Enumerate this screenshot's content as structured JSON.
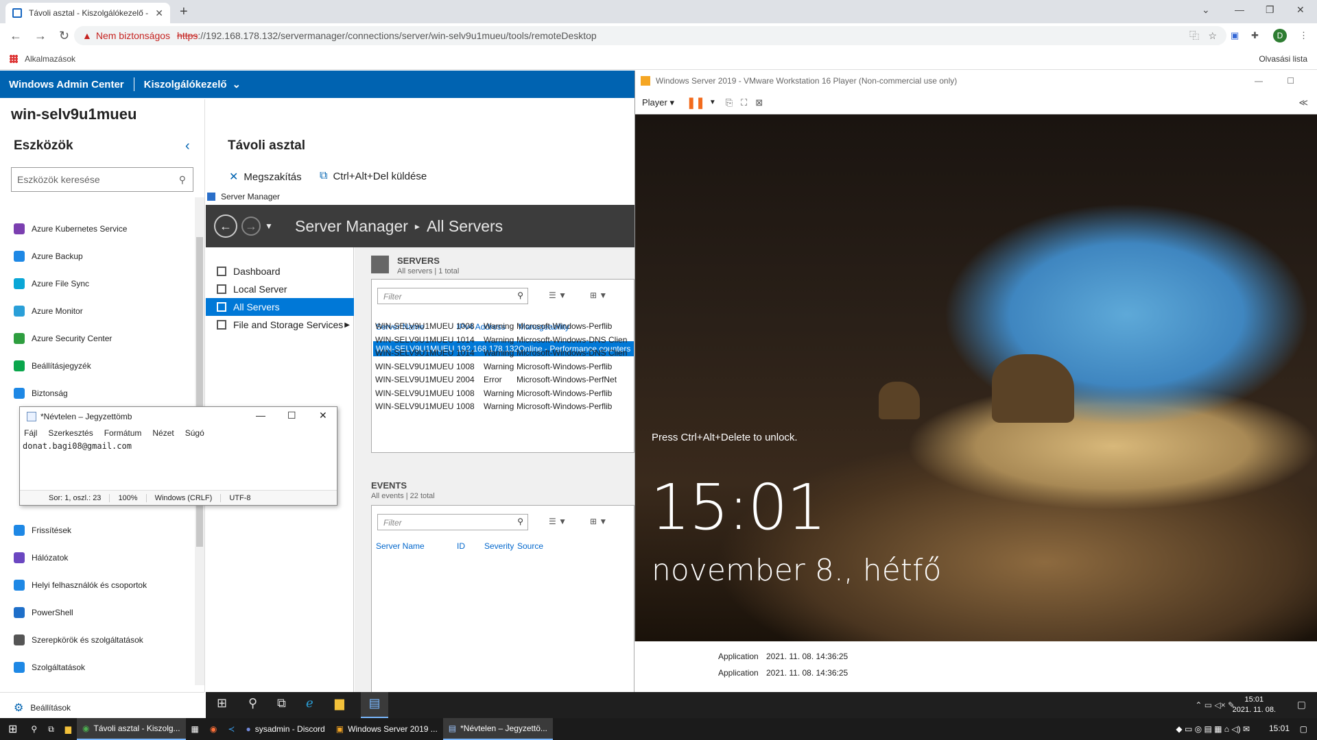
{
  "browser": {
    "tab_title": "Távoli asztal - Kiszolgálókezelő -",
    "url_warning": "Nem biztonságos",
    "url_scheme": "https",
    "url_rest": "://192.168.178.132/servermanager/connections/server/win-selv9u1mueu/tools/remoteDesktop",
    "bookmarks_apps": "Alkalmazások",
    "reading_list": "Olvasási lista",
    "profile_initial": "D"
  },
  "wac": {
    "brand": "Windows Admin Center",
    "section": "Kiszolgálókezelő",
    "server": "win-selv9u1mueu",
    "tools_heading": "Eszközök",
    "search_placeholder": "Eszközök keresése",
    "tools": [
      "Azure Kubernetes Service",
      "Azure Backup",
      "Azure File Sync",
      "Azure Monitor",
      "Azure Security Center",
      "Beállításjegyzék",
      "Biztonság",
      "Frissítések",
      "Hálózatok",
      "Helyi felhasználók és csoportok",
      "PowerShell",
      "Szerepkörök és szolgáltatások",
      "Szolgáltatások"
    ],
    "tool_colors": [
      "#7b3fb0",
      "#1e88e5",
      "#0aa6d6",
      "#2a9fd8",
      "#2e9e3f",
      "#0aa64c",
      "#1e88e5",
      "#1e88e5",
      "#6b47c1",
      "#1e88e5",
      "#1e6fc9",
      "#555555",
      "#1e88e5"
    ],
    "settings": "Beállítások",
    "rd_title": "Távoli asztal",
    "disconnect": "Megszakítás",
    "cad": "Ctrl+Alt+Del küldése"
  },
  "servermanager": {
    "label": "Server Manager",
    "crumb1": "Server Manager",
    "crumb2": "All Servers",
    "nav": [
      "Dashboard",
      "Local Server",
      "All Servers",
      "File and Storage Services"
    ],
    "servers_title": "SERVERS",
    "servers_sub": "All servers | 1 total",
    "filter": "Filter",
    "cols": [
      "Server Name",
      "IPv4 Address",
      "Manageability"
    ],
    "server_row": [
      "WIN-SELV9U1MUEU",
      "192.168.178.132",
      "Online - Performance counters"
    ],
    "events_title": "EVENTS",
    "events_sub": "All events | 22 total",
    "ev_cols": [
      "Server Name",
      "ID",
      "Severity",
      "Source"
    ],
    "events": [
      [
        "WIN-SELV9U1MUEU",
        "1008",
        "Warning",
        "Microsoft-Windows-Perflib"
      ],
      [
        "WIN-SELV9U1MUEU",
        "1014",
        "Warning",
        "Microsoft-Windows-DNS Clien"
      ],
      [
        "WIN-SELV9U1MUEU",
        "1014",
        "Warning",
        "Microsoft-Windows-DNS Clien"
      ],
      [
        "WIN-SELV9U1MUEU",
        "1008",
        "Warning",
        "Microsoft-Windows-Perflib"
      ],
      [
        "WIN-SELV9U1MUEU",
        "2004",
        "Error",
        "Microsoft-Windows-PerfNet"
      ],
      [
        "WIN-SELV9U1MUEU",
        "1008",
        "Warning",
        "Microsoft-Windows-Perflib"
      ],
      [
        "WIN-SELV9U1MUEU",
        "1008",
        "Warning",
        "Microsoft-Windows-Perflib"
      ]
    ],
    "ev_extra": [
      [
        "Application",
        "2021. 11. 08. 14:36:25"
      ],
      [
        "Application",
        "2021. 11. 08. 14:36:25"
      ]
    ]
  },
  "notepad": {
    "title": "*Névtelen – Jegyzettömb",
    "menu": [
      "Fájl",
      "Szerkesztés",
      "Formátum",
      "Nézet",
      "Súgó"
    ],
    "text": "donat.bagi08@gmail.com",
    "status": [
      "Sor: 1, oszl.: 23",
      "100%",
      "Windows (CRLF)",
      "UTF-8"
    ]
  },
  "vmware": {
    "title": "Windows Server 2019 - VMware Workstation 16 Player (Non-commercial use only)",
    "player": "Player",
    "press": "Press Ctrl+Alt+Delete to unlock.",
    "time": "15:01",
    "date": "november 8., hétfő"
  },
  "inner_taskbar": {
    "time": "15:01",
    "date": "2021. 11. 08."
  },
  "outer_taskbar": {
    "items": [
      "Távoli asztal - Kiszolg...",
      "sysadmin - Discord",
      "Windows Server 2019 ...",
      "*Névtelen – Jegyzettö..."
    ],
    "time": "15:01"
  }
}
